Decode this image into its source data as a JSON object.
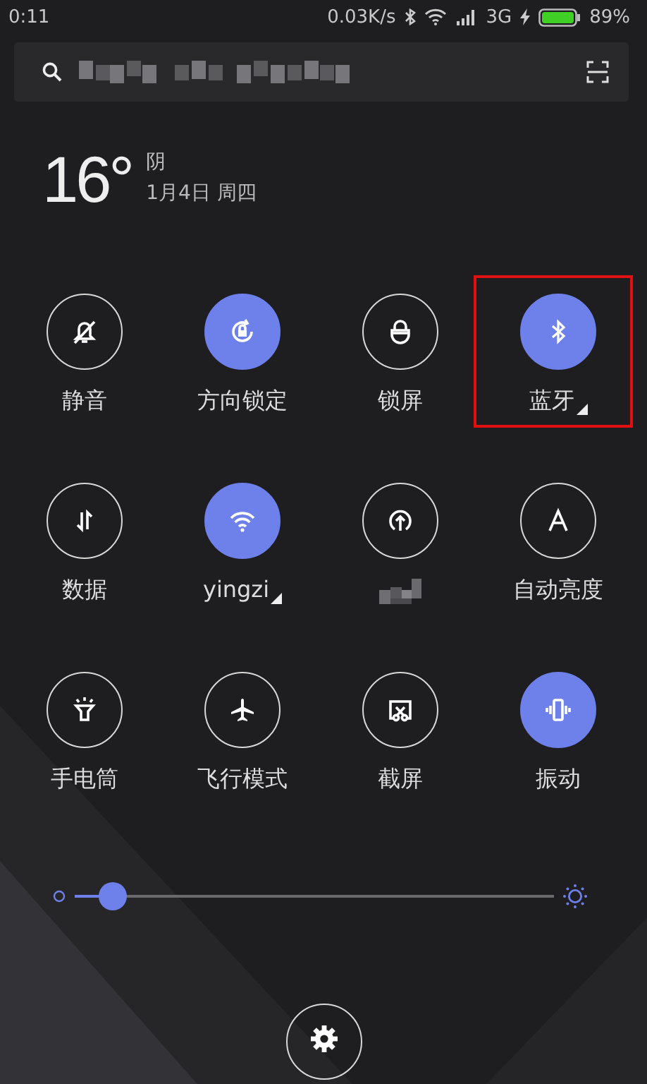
{
  "status_bar": {
    "time": "0:11",
    "speed": "0.03K/s",
    "network": "3G",
    "battery": "89%"
  },
  "weather": {
    "temperature": "16°",
    "condition": "阴",
    "date": "1月4日 周四"
  },
  "tiles": [
    {
      "label": "静音",
      "on": false,
      "dropdown": false,
      "highlighted": false,
      "pixelated": false
    },
    {
      "label": "方向锁定",
      "on": true,
      "dropdown": false,
      "highlighted": false,
      "pixelated": false
    },
    {
      "label": "锁屏",
      "on": false,
      "dropdown": false,
      "highlighted": false,
      "pixelated": false
    },
    {
      "label": "蓝牙",
      "on": true,
      "dropdown": true,
      "highlighted": true,
      "pixelated": false
    },
    {
      "label": "数据",
      "on": false,
      "dropdown": false,
      "highlighted": false,
      "pixelated": false
    },
    {
      "label": "yingzi",
      "on": true,
      "dropdown": true,
      "highlighted": false,
      "pixelated": false
    },
    {
      "on": false,
      "dropdown": false,
      "highlighted": false,
      "pixelated": true
    },
    {
      "label": "自动亮度",
      "on": false,
      "dropdown": false,
      "highlighted": false,
      "pixelated": false
    },
    {
      "label": "手电筒",
      "on": false,
      "dropdown": false,
      "highlighted": false,
      "pixelated": false
    },
    {
      "label": "飞行模式",
      "on": false,
      "dropdown": false,
      "highlighted": false,
      "pixelated": false
    },
    {
      "label": "截屏",
      "on": false,
      "dropdown": false,
      "highlighted": false,
      "pixelated": false
    },
    {
      "label": "振动",
      "on": true,
      "dropdown": false,
      "highlighted": false,
      "pixelated": false
    }
  ],
  "brightness": {
    "level": 0.08
  }
}
